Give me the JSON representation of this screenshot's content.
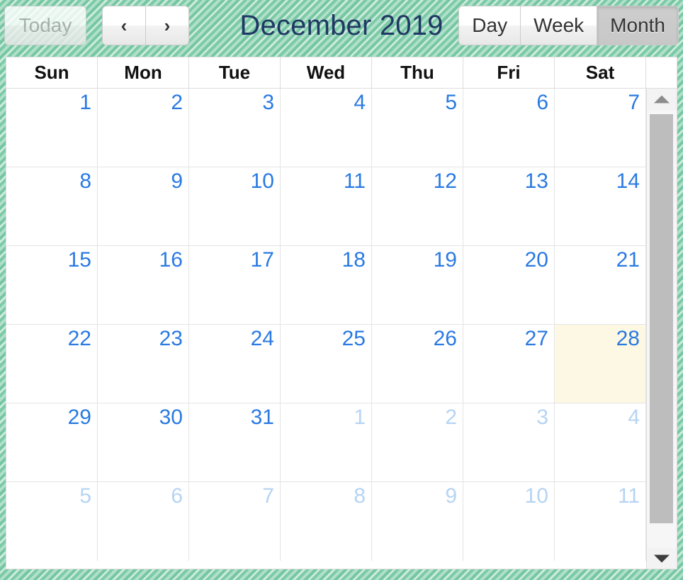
{
  "toolbar": {
    "today_label": "Today",
    "today_disabled": true,
    "prev_icon": "‹",
    "next_icon": "›",
    "title": "December 2019",
    "views": [
      {
        "label": "Day",
        "active": false
      },
      {
        "label": "Week",
        "active": false
      },
      {
        "label": "Month",
        "active": true
      }
    ]
  },
  "calendar": {
    "weekday_headers": [
      "Sun",
      "Mon",
      "Tue",
      "Wed",
      "Thu",
      "Fri",
      "Sat"
    ],
    "weeks": [
      [
        {
          "day": "1",
          "other_month": false,
          "today": false
        },
        {
          "day": "2",
          "other_month": false,
          "today": false
        },
        {
          "day": "3",
          "other_month": false,
          "today": false
        },
        {
          "day": "4",
          "other_month": false,
          "today": false
        },
        {
          "day": "5",
          "other_month": false,
          "today": false
        },
        {
          "day": "6",
          "other_month": false,
          "today": false
        },
        {
          "day": "7",
          "other_month": false,
          "today": false
        }
      ],
      [
        {
          "day": "8",
          "other_month": false,
          "today": false
        },
        {
          "day": "9",
          "other_month": false,
          "today": false
        },
        {
          "day": "10",
          "other_month": false,
          "today": false
        },
        {
          "day": "11",
          "other_month": false,
          "today": false
        },
        {
          "day": "12",
          "other_month": false,
          "today": false
        },
        {
          "day": "13",
          "other_month": false,
          "today": false
        },
        {
          "day": "14",
          "other_month": false,
          "today": false
        }
      ],
      [
        {
          "day": "15",
          "other_month": false,
          "today": false
        },
        {
          "day": "16",
          "other_month": false,
          "today": false
        },
        {
          "day": "17",
          "other_month": false,
          "today": false
        },
        {
          "day": "18",
          "other_month": false,
          "today": false
        },
        {
          "day": "19",
          "other_month": false,
          "today": false
        },
        {
          "day": "20",
          "other_month": false,
          "today": false
        },
        {
          "day": "21",
          "other_month": false,
          "today": false
        }
      ],
      [
        {
          "day": "22",
          "other_month": false,
          "today": false
        },
        {
          "day": "23",
          "other_month": false,
          "today": false
        },
        {
          "day": "24",
          "other_month": false,
          "today": false
        },
        {
          "day": "25",
          "other_month": false,
          "today": false
        },
        {
          "day": "26",
          "other_month": false,
          "today": false
        },
        {
          "day": "27",
          "other_month": false,
          "today": false
        },
        {
          "day": "28",
          "other_month": false,
          "today": true
        }
      ],
      [
        {
          "day": "29",
          "other_month": false,
          "today": false
        },
        {
          "day": "30",
          "other_month": false,
          "today": false
        },
        {
          "day": "31",
          "other_month": false,
          "today": false
        },
        {
          "day": "1",
          "other_month": true,
          "today": false
        },
        {
          "day": "2",
          "other_month": true,
          "today": false
        },
        {
          "day": "3",
          "other_month": true,
          "today": false
        },
        {
          "day": "4",
          "other_month": true,
          "today": false
        }
      ],
      [
        {
          "day": "5",
          "other_month": true,
          "today": false
        },
        {
          "day": "6",
          "other_month": true,
          "today": false
        },
        {
          "day": "7",
          "other_month": true,
          "today": false
        },
        {
          "day": "8",
          "other_month": true,
          "today": false
        },
        {
          "day": "9",
          "other_month": true,
          "today": false
        },
        {
          "day": "10",
          "other_month": true,
          "today": false
        },
        {
          "day": "11",
          "other_month": true,
          "today": false
        }
      ]
    ]
  },
  "scrollbar": {
    "up_icon": "scroll-up-arrow",
    "down_icon": "scroll-down-arrow"
  },
  "colors": {
    "title": "#1f3864",
    "day_number": "#2a7ae2",
    "day_number_muted": "#b6d4f3",
    "today_background": "#fcf8e3",
    "page_background": "#8ed3b4"
  }
}
